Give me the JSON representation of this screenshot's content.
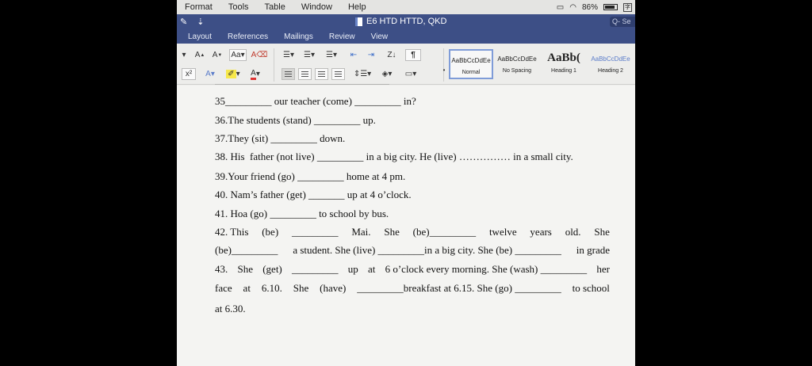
{
  "menubar": {
    "items": [
      "Format",
      "Tools",
      "Table",
      "Window",
      "Help"
    ],
    "battery_percent": "86%"
  },
  "title": "E6 HTD HTTD, QKD",
  "ribbon_tabs": [
    "Layout",
    "References",
    "Mailings",
    "Review",
    "View"
  ],
  "search_placeholder": "Q- Se",
  "toolbar": {
    "grow_font": "A",
    "shrink_font": "A",
    "superscript": "x²",
    "text_effects": "A",
    "font_color": "A",
    "sort": "Z↓",
    "show_marks": "¶"
  },
  "styles": [
    {
      "preview": "AaBbCcDdEe",
      "name": "Normal"
    },
    {
      "preview": "AaBbCcDdEe",
      "name": "No Spacing"
    },
    {
      "preview": "AaBb(",
      "name": "Heading 1"
    },
    {
      "preview": "AaBbCcDdEe",
      "name": "Heading 2"
    }
  ],
  "document": {
    "lines": [
      "35_________ our teacher (come) _________ in?",
      "36.The students (stand) _________ up.",
      "37.They (sit) _________ down.",
      "38. His  father (not live) _________ in a big city. He (live) …………… in a small city.",
      "39.Your friend (go) _________ home at 4 pm.",
      "40. Nam’s father (get) _______ up at 4 o’clock.",
      "41. Hoa (go) _________ to school by bus."
    ],
    "q42_line1": [
      "42. This",
      "(be)",
      "_________",
      "Mai.",
      "She",
      "(be)_________",
      "twelve",
      "years",
      "old.",
      "She"
    ],
    "q42_line2": [
      "(be)_________",
      "a student. She (live) _________in a big city. She (be) _________",
      "in grade"
    ],
    "q43_line1": [
      "43.",
      "She",
      "(get)",
      "_________",
      "up",
      "at",
      "6 o’clock every morning. She (wash) _________",
      "her"
    ],
    "q43_line2": [
      "face",
      "at",
      "6.10.",
      "She",
      "(have)",
      "_________breakfast at 6.15. She (go) _________",
      "to school"
    ],
    "q43_line3": "at 6.30."
  }
}
